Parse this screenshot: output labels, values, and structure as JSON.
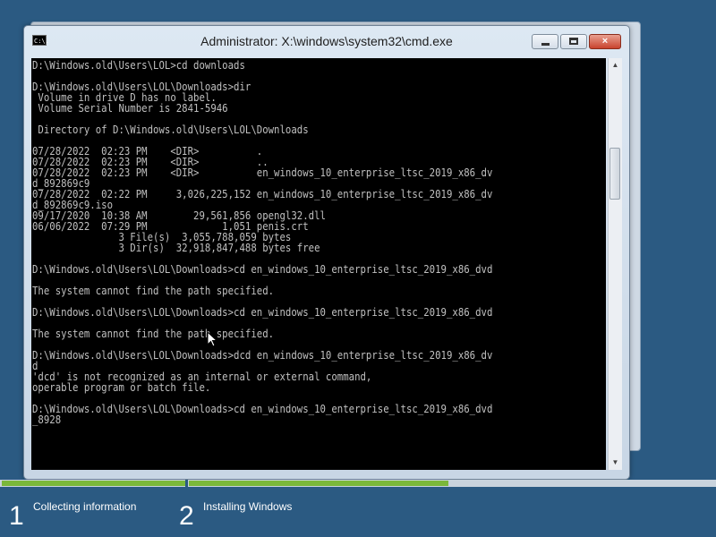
{
  "window": {
    "title": "Administrator: X:\\windows\\system32\\cmd.exe",
    "icon_label": "C:\\.",
    "controls": {
      "minimize": "minimize-icon",
      "maximize": "maximize-icon",
      "close": "×"
    }
  },
  "console": {
    "lines": [
      "D:\\Windows.old\\Users\\LOL>cd downloads",
      "",
      "D:\\Windows.old\\Users\\LOL\\Downloads>dir",
      " Volume in drive D has no label.",
      " Volume Serial Number is 2841-5946",
      "",
      " Directory of D:\\Windows.old\\Users\\LOL\\Downloads",
      "",
      "07/28/2022  02:23 PM    <DIR>          .",
      "07/28/2022  02:23 PM    <DIR>          ..",
      "07/28/2022  02:23 PM    <DIR>          en_windows_10_enterprise_ltsc_2019_x86_dv",
      "d_892869c9",
      "07/28/2022  02:22 PM     3,026,225,152 en_windows_10_enterprise_ltsc_2019_x86_dv",
      "d_892869c9.iso",
      "09/17/2020  10:38 AM        29,561,856 opengl32.dll",
      "06/06/2022  07:29 PM             1,051 penis.crt",
      "               3 File(s)  3,055,788,059 bytes",
      "               3 Dir(s)  32,918,847,488 bytes free",
      "",
      "D:\\Windows.old\\Users\\LOL\\Downloads>cd en_windows_10_enterprise_ltsc_2019_x86_dvd",
      "",
      "The system cannot find the path specified.",
      "",
      "D:\\Windows.old\\Users\\LOL\\Downloads>cd en_windows_10_enterprise_ltsc_2019_x86_dvd",
      "",
      "The system cannot find the path specified.",
      "",
      "D:\\Windows.old\\Users\\LOL\\Downloads>dcd en_windows_10_enterprise_ltsc_2019_x86_dv",
      "d",
      "'dcd' is not recognized as an internal or external command,",
      "operable program or batch file.",
      "",
      "D:\\Windows.old\\Users\\LOL\\Downloads>cd en_windows_10_enterprise_ltsc_2019_x86_dvd",
      "_8928"
    ],
    "text_color": "#c0c0c0",
    "background": "#000000"
  },
  "setup": {
    "steps": [
      {
        "number": "1",
        "label": "Collecting information"
      },
      {
        "number": "2",
        "label": "Installing Windows"
      }
    ],
    "progress": {
      "collecting": 1.0,
      "installing": 0.55
    },
    "progress_color": "#7ab83a"
  },
  "colors": {
    "desktop": "#2b5a82"
  }
}
